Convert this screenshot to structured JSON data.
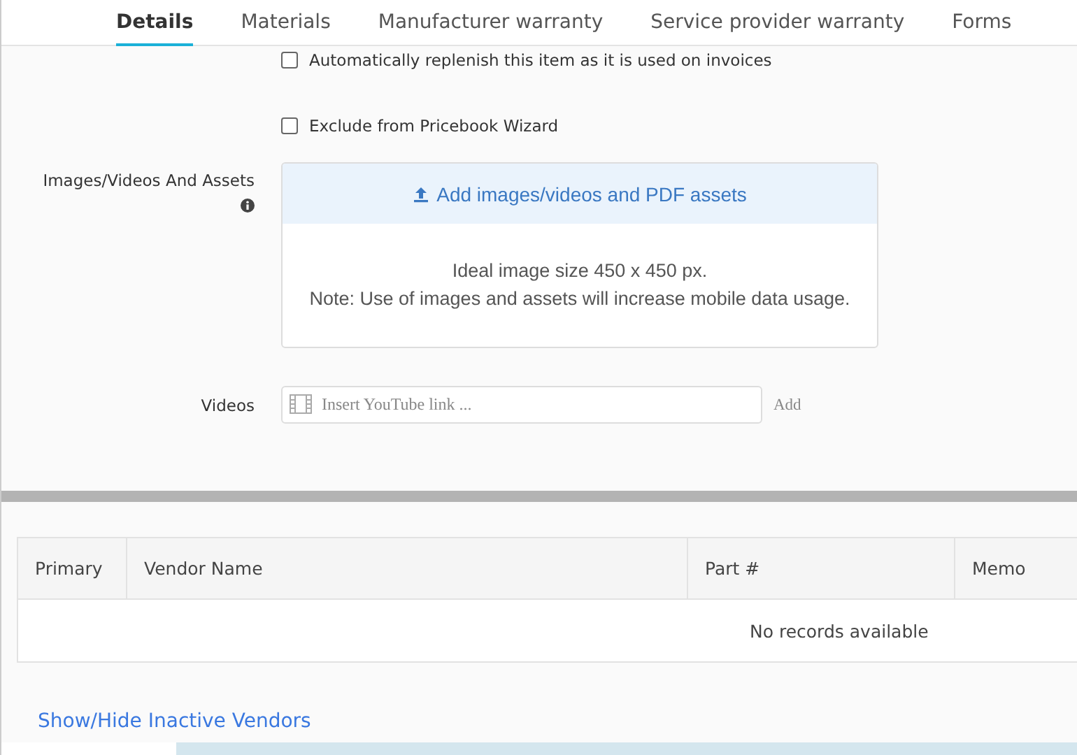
{
  "tabs": [
    {
      "label": "Details",
      "selected": true
    },
    {
      "label": "Materials",
      "selected": false
    },
    {
      "label": "Manufacturer warranty",
      "selected": false
    },
    {
      "label": "Service provider warranty",
      "selected": false
    },
    {
      "label": "Forms",
      "selected": false
    }
  ],
  "options": [
    {
      "label": "Automatically replenish this item as it is used on invoices",
      "checked": false
    },
    {
      "label": "Exclude from Pricebook Wizard",
      "checked": false
    }
  ],
  "assets": {
    "label": "Images/Videos And Assets",
    "upload_button": "Add images/videos and PDF assets",
    "notes": [
      "Ideal image size 450 x 450 px.",
      "Note: Use of images and assets will increase mobile data usage."
    ]
  },
  "videos": {
    "label": "Videos",
    "placeholder": "Insert YouTube link ...",
    "add_button": "Add"
  },
  "vendors_table": {
    "columns": [
      "Primary",
      "Vendor Name",
      "Part #",
      "Memo"
    ],
    "empty_message": "No records available"
  },
  "toggle_link": "Show/Hide Inactive Vendors"
}
